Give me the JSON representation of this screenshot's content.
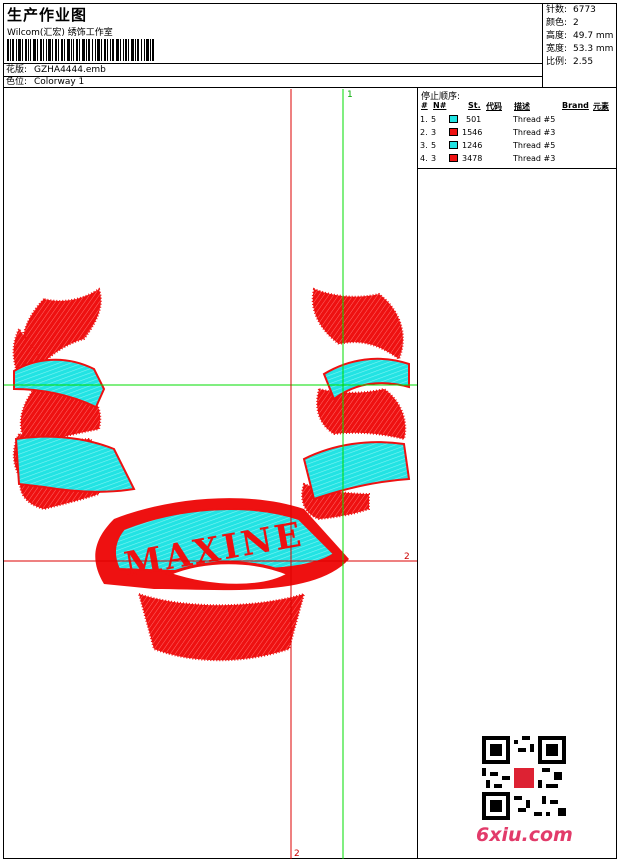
{
  "header": {
    "title": "生产作业图",
    "subtitle": "Wilcom(汇宏) 绣饰工作室",
    "design_label": "花版:",
    "design_value": "GZHA4444.emb",
    "colorway_label": "色位:",
    "colorway_value": "Colorway 1"
  },
  "stats": [
    {
      "label": "针数:",
      "value": "6773"
    },
    {
      "label": "颜色:",
      "value": "2"
    },
    {
      "label": "高度:",
      "value": "49.7 mm"
    },
    {
      "label": "宽度:",
      "value": "53.3 mm"
    },
    {
      "label": "比例:",
      "value": "2.55"
    }
  ],
  "stop_sequence": {
    "title": "停止顺序:",
    "headers": {
      "num": "#",
      "n": "N#",
      "st": "St.",
      "code": "代码",
      "desc": "描述",
      "brand": "Brand",
      "element": "元素"
    },
    "rows": [
      {
        "num": "1.",
        "n": "5",
        "st": "501",
        "desc": "Thread #5",
        "color": "#22e3e3"
      },
      {
        "num": "2.",
        "n": "3",
        "st": "1546",
        "desc": "Thread #3",
        "color": "#ee1111"
      },
      {
        "num": "3.",
        "n": "5",
        "st": "1246",
        "desc": "Thread #5",
        "color": "#22e3e3"
      },
      {
        "num": "4.",
        "n": "3",
        "st": "3478",
        "desc": "Thread #3",
        "color": "#ee1111"
      }
    ]
  },
  "canvas": {
    "banner_text": "MAXINE",
    "guides": {
      "v1": "1",
      "v2": "2",
      "h2": "2"
    },
    "colors": {
      "red": "#ee1111",
      "cyan": "#22e3e3",
      "green": "#00dd00",
      "red_guide": "#dd0000"
    }
  },
  "watermark": {
    "text": "6xiu.com"
  }
}
